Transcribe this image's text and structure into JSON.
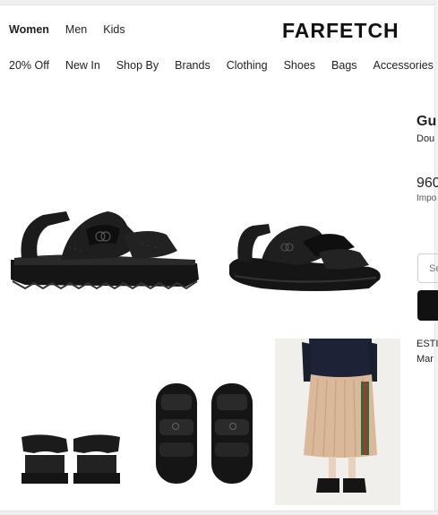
{
  "header": {
    "gender_tabs": [
      {
        "label": "Women",
        "active": true
      },
      {
        "label": "Men",
        "active": false
      },
      {
        "label": "Kids",
        "active": false
      }
    ],
    "logo_text": "FARFETCH"
  },
  "categories": [
    "20% Off",
    "New In",
    "Shop By",
    "Brands",
    "Clothing",
    "Shoes",
    "Bags",
    "Accessories"
  ],
  "product": {
    "brand_partial": "Gu",
    "description_partial": "Dou",
    "price_partial": "960",
    "import_note_partial": "Impo",
    "size_placeholder_partial": "Se",
    "estimated_partial": "ESTI",
    "date_partial": "Mar"
  },
  "gallery": [
    {
      "name": "sandal-side-view"
    },
    {
      "name": "sandal-angled-view"
    },
    {
      "name": "sandals-back-view"
    },
    {
      "name": "sandals-top-view"
    },
    {
      "name": "model-wearing-sandals"
    }
  ],
  "colors": {
    "text": "#222222",
    "button": "#111111",
    "skirt": "#d9b99a"
  }
}
